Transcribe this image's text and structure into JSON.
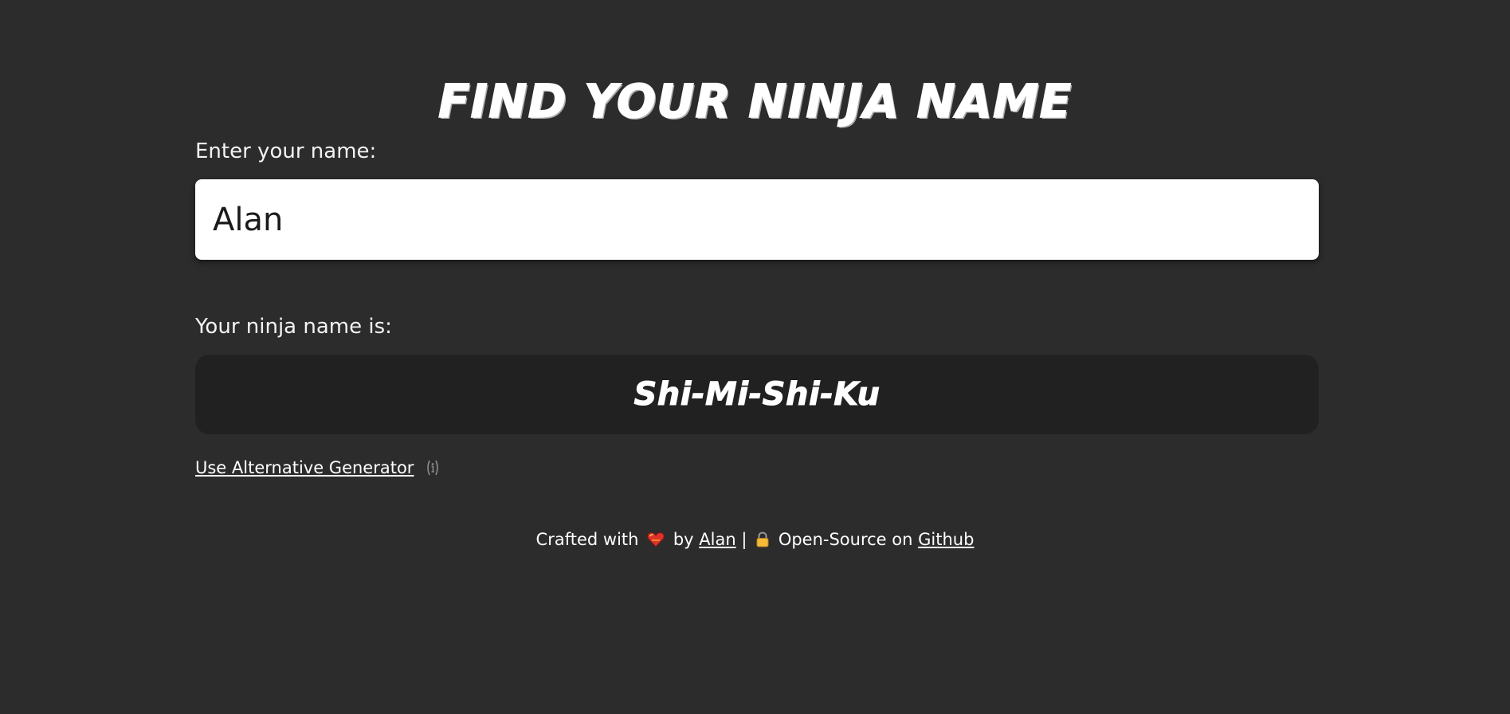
{
  "header": {
    "title": "FIND YOUR NINJA NAME"
  },
  "form": {
    "label": "Enter your name:",
    "input_value": "Alan"
  },
  "result": {
    "label": "Your ninja name is:",
    "ninja_name": "Shi-Mi-Shi-Ku"
  },
  "alternative": {
    "link_label": "Use Alternative Generator",
    "info_icon": "info-icon"
  },
  "footer": {
    "crafted_text": "Crafted with",
    "heart_icon": "heart-icon",
    "by_text": "by",
    "author_link": "Alan",
    "separator": "|",
    "lock_icon": "lock-icon",
    "open_source_text": "Open-Source on",
    "github_link": "Github"
  },
  "colors": {
    "background": "#2c2c2c",
    "result_box": "#212121",
    "input_background": "#ffffff",
    "text": "#ffffff",
    "heart": "#e0312b",
    "lock": "#f5b93a"
  }
}
